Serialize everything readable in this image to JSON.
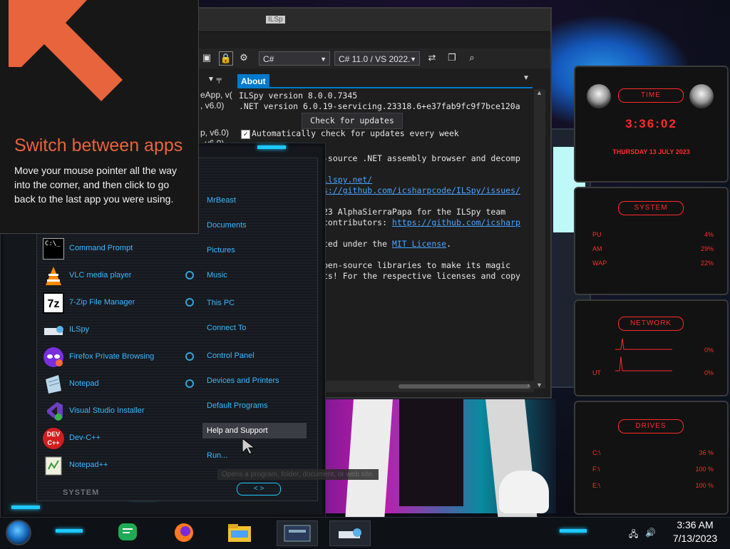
{
  "tip": {
    "title": "Switch between apps",
    "body": "Move your mouse pointer all the way into the corner, and then click to go back to the last app you were using."
  },
  "ilspy": {
    "title": "ILSp",
    "language": "C#",
    "version_select": "C# 11.0 / VS 2022.",
    "tree_items": [
      "eApp, v(",
      ", v6.0)",
      "p, v6.0)",
      ", v6.0)"
    ],
    "about_tab": "About",
    "version_line": "ILSpy version 8.0.0.7345",
    "net_line": ".NET version 6.0.19-servicing.23318.6+e37fab9fc9f7bce120a",
    "check_button": "Check for updates",
    "auto_check_label": "Automatically check for updates every week",
    "desc_line": "-source .NET assembly browser and decomp",
    "link1": "ilspy.net/",
    "link2": "s://github.com/icsharpcode/ILSpy/issues/",
    "copyright": "23 AlphaSierraPapa for the ILSpy team",
    "contributors_prefix": "contributors: ",
    "contributors_link": "https://github.com/icsharp",
    "license_prefix": "ted under the ",
    "license_link": "MIT License",
    "license_suffix": ".",
    "open_source_1": "pen-source libraries to make its magic",
    "open_source_2": "ts! For the respective licenses and copy"
  },
  "start_menu": {
    "apps": [
      {
        "label": "Command Prompt",
        "pinned": false
      },
      {
        "label": "VLC media player",
        "pinned": true
      },
      {
        "label": "7-Zip File Manager",
        "pinned": true
      },
      {
        "label": "ILSpy",
        "pinned": false
      },
      {
        "label": "Firefox Private Browsing",
        "pinned": true
      },
      {
        "label": "Notepad",
        "pinned": true
      },
      {
        "label": "Visual Studio Installer",
        "pinned": false
      },
      {
        "label": "Dev-C++",
        "pinned": false
      },
      {
        "label": "Notepad++",
        "pinned": false
      }
    ],
    "places": [
      "MrBeast",
      "Documents",
      "Pictures",
      "Music",
      "This PC",
      "Connect To",
      "Control Panel",
      "Devices and Printers",
      "Default Programs",
      "Help and Support",
      "Run..."
    ],
    "highlighted_place": "Help and Support",
    "tooltip": "Opens a program, folder, document, or web site.",
    "system_label": "SYSTEM"
  },
  "widgets": {
    "time": {
      "title": "TIME",
      "clock": "3:36:02",
      "date": "THURSDAY 13 JULY 2023"
    },
    "system": {
      "title": "SYSTEM",
      "rows": [
        {
          "label": "PU",
          "value": "4%"
        },
        {
          "label": "AM",
          "value": "29%"
        },
        {
          "label": "WAP",
          "value": "22%"
        }
      ]
    },
    "network": {
      "title": "NETWORK",
      "rows": [
        {
          "label": "",
          "value": "0%"
        },
        {
          "label": "UT",
          "value": "0%"
        }
      ]
    },
    "drives": {
      "title": "DRIVES",
      "rows": [
        {
          "label": "C:\\",
          "value": "36 %"
        },
        {
          "label": "F:\\",
          "value": "100 %"
        },
        {
          "label": "E:\\",
          "value": "100 %"
        }
      ]
    }
  },
  "taskbar": {
    "time": "3:36 AM",
    "date": "7/13/2023"
  },
  "colors": {
    "accent_cyan": "#1ec9ff",
    "widget_red": "#ff2a2a",
    "tip_orange": "#e8643c",
    "ilspy_blue": "#007acc"
  }
}
